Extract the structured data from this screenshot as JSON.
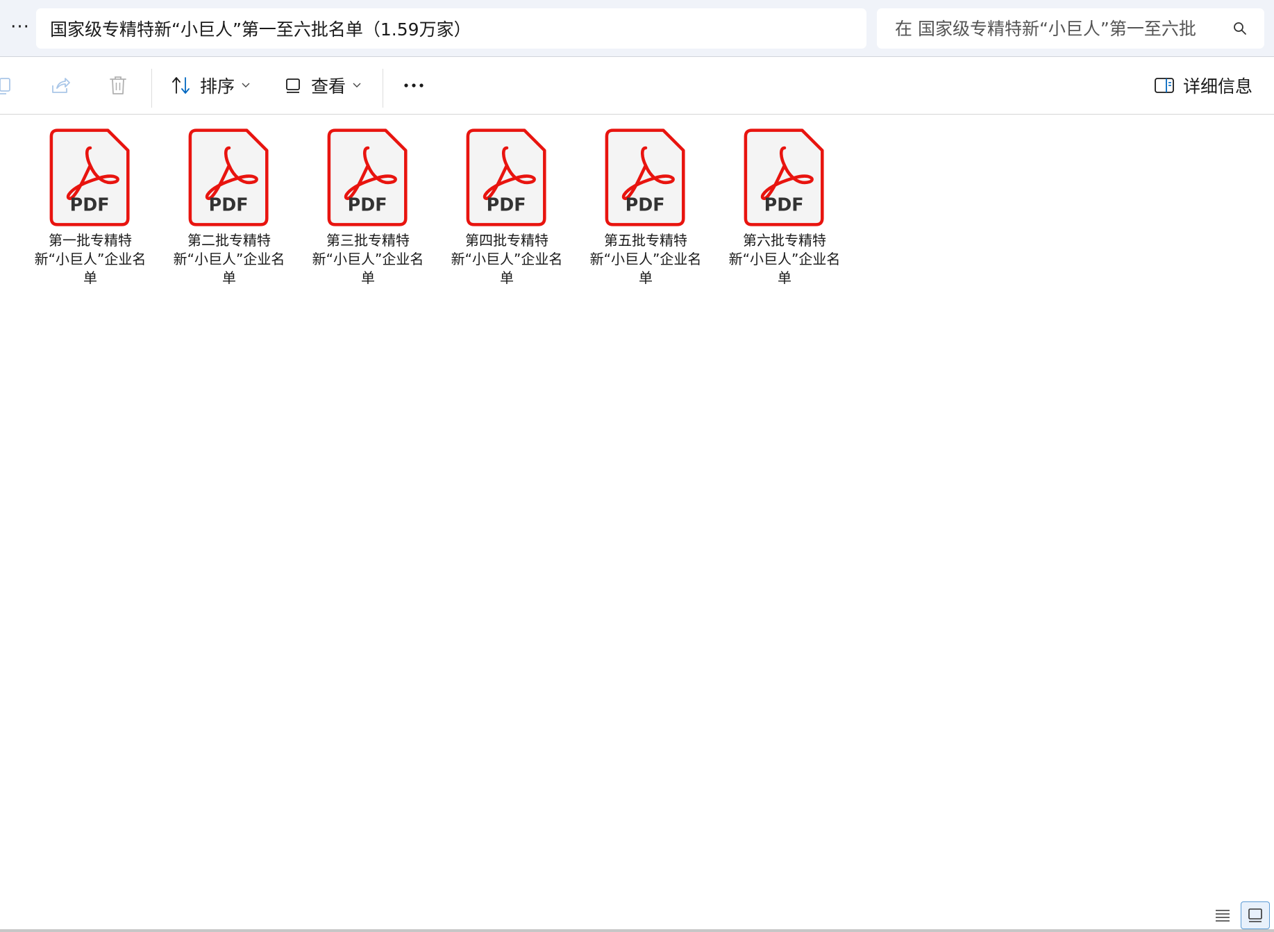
{
  "titlebar": {
    "more_label": "···",
    "address": "国家级专精特新“小巨人”第一至六批名单（1.59万家）",
    "search_placeholder": "在 国家级专精特新“小巨人”第一至六批"
  },
  "toolbar": {
    "sort_label": "排序",
    "view_label": "查看",
    "more_label": "···",
    "details_label": "详细信息",
    "accent_color": "#0067c0"
  },
  "files": [
    {
      "name": "第一批专精特新“小巨人”企业名单",
      "icon": "pdf-icon",
      "badge": "PDF"
    },
    {
      "name": "第二批专精特新“小巨人”企业名单",
      "icon": "pdf-icon",
      "badge": "PDF"
    },
    {
      "name": "第三批专精特新“小巨人”企业名单",
      "icon": "pdf-icon",
      "badge": "PDF"
    },
    {
      "name": "第四批专精特新“小巨人”企业名单",
      "icon": "pdf-icon",
      "badge": "PDF"
    },
    {
      "name": "第五批专精特新“小巨人”企业名单",
      "icon": "pdf-icon",
      "badge": "PDF"
    },
    {
      "name": "第六批专精特新“小巨人”企业名单",
      "icon": "pdf-icon",
      "badge": "PDF"
    }
  ],
  "colors": {
    "pdf_red": "#e8140f",
    "titlebar_bg": "#f0f3f9"
  }
}
